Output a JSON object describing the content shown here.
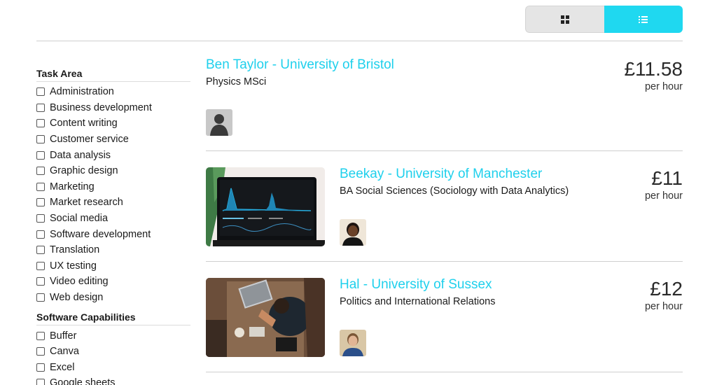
{
  "view_toggle": {
    "grid_icon": "grid-icon",
    "list_icon": "list-icon",
    "active": "list",
    "active_color": "#1fd8f0"
  },
  "sidebar": {
    "groups": [
      {
        "title": "Task Area",
        "items": [
          "Administration",
          "Business development",
          "Content writing",
          "Customer service",
          "Data analysis",
          "Graphic design",
          "Marketing",
          "Market research",
          "Social media",
          "Software development",
          "Translation",
          "UX testing",
          "Video editing",
          "Web design"
        ]
      },
      {
        "title": "Software Capabilities",
        "items": [
          "Buffer",
          "Canva",
          "Excel",
          "Google sheets"
        ]
      }
    ]
  },
  "listings": [
    {
      "name": "Ben Taylor - University of Bristol",
      "course": "Physics MSci",
      "price": "£11.58",
      "unit": "per hour",
      "avatar": "default-avatar",
      "cover_image": null
    },
    {
      "name": "Beekay - University of Manchester",
      "course": "BA Social Sciences (Sociology with Data Analytics)",
      "price": "£11",
      "unit": "per hour",
      "avatar": "student-avatar",
      "cover_image": "analytics-dashboard-laptop"
    },
    {
      "name": "Hal - University of Sussex",
      "course": "Politics and International Relations",
      "price": "£12",
      "unit": "per hour",
      "avatar": "student-avatar",
      "cover_image": "person-at-laptop-desk"
    }
  ],
  "colors": {
    "accent": "#1fd0ec",
    "text": "#1a1a1a",
    "rule": "#cfcfcf"
  }
}
